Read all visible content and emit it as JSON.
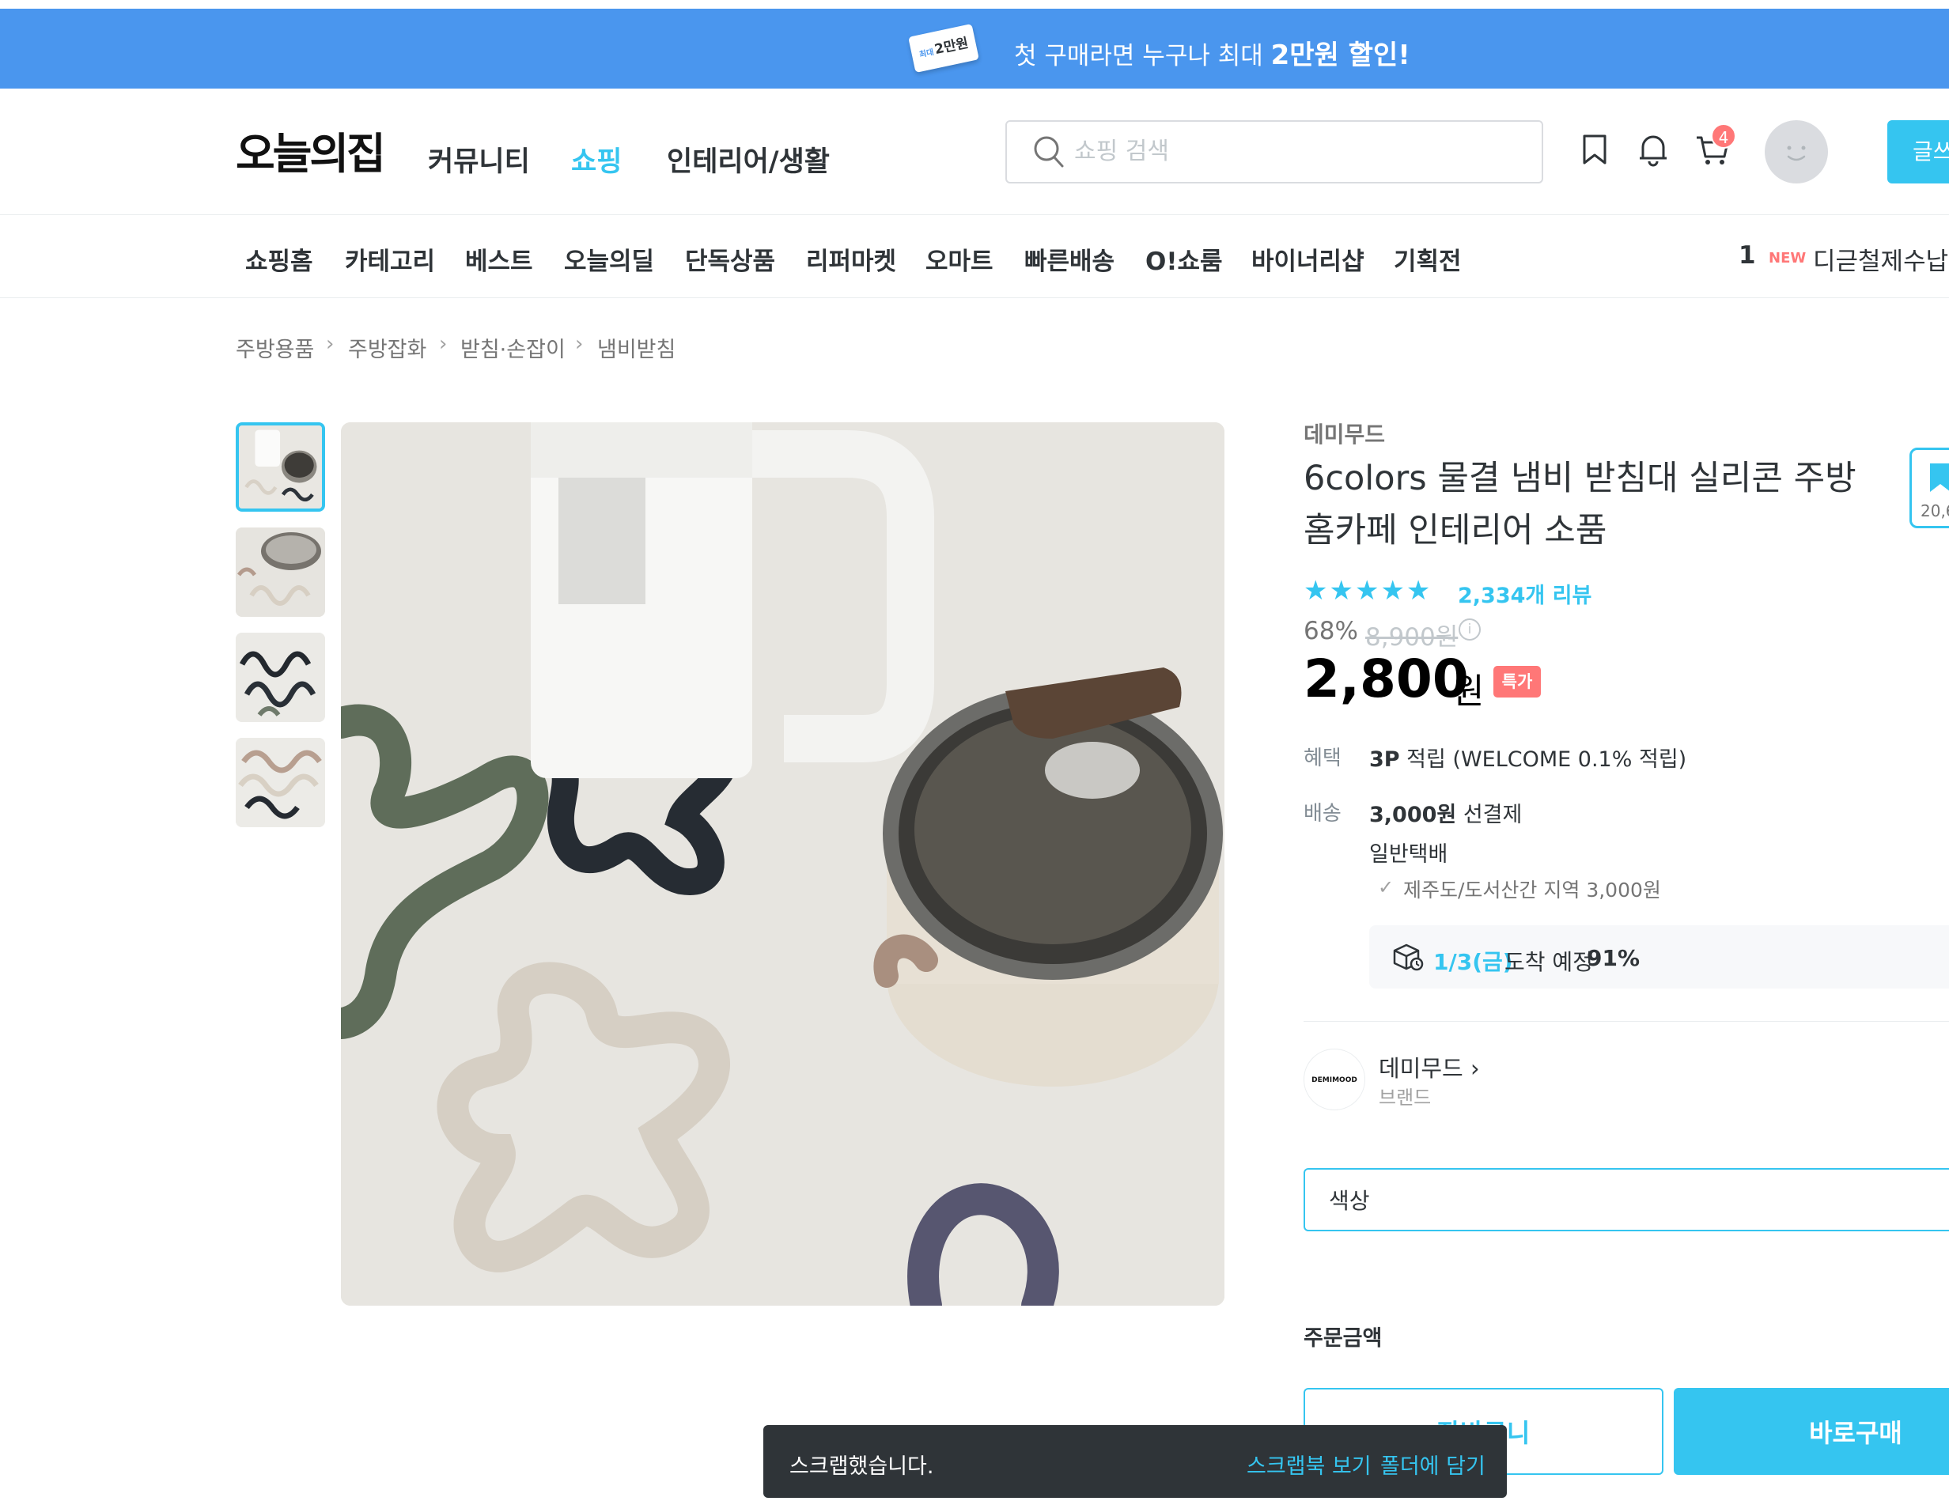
{
  "promo": {
    "ticket_label": "2만원",
    "ticket_small": "최대",
    "text_prefix": "첫 구매라면 누구나 최대 ",
    "text_highlight": "2만원 할인!",
    "arrow": "›"
  },
  "header": {
    "logo": "오늘의집",
    "nav": [
      "커뮤니티",
      "쇼핑",
      "인테리어/생활"
    ],
    "search_placeholder": "쇼핑 검색",
    "cart_count": "4",
    "write_label": "글쓰기"
  },
  "category_nav": {
    "items": [
      "쇼핑홈",
      "카테고리",
      "베스트",
      "오늘의딜",
      "단독상품",
      "리퍼마켓",
      "오마트",
      "빠른배송",
      "O!쇼룸",
      "바이너리샵",
      "기획전"
    ],
    "trending_rank": "1",
    "trending_badge": "NEW",
    "trending_text": "디귿철제수납함"
  },
  "breadcrumb": [
    "주방용품",
    "주방잡화",
    "받침·손잡이",
    "냄비받침"
  ],
  "product": {
    "brand": "데미무드",
    "title": "6colors 물결 냄비 받침대 실리콘 주방 홈카페 인테리어 소품",
    "stars": "★★★★★",
    "review_count": "2,334개 리뷰",
    "discount_rate": "68%",
    "original_price": "8,900원",
    "sale_price": "2,800",
    "price_unit": "원",
    "special_badge": "특가",
    "benefit_label": "혜택",
    "benefit_value_bold": "3P",
    "benefit_value": " 적립 (WELCOME 0.1% 적립)",
    "delivery_label": "배송",
    "delivery_fee_bold": "3,000원",
    "delivery_fee": " 선결제",
    "delivery_type": "일반택배",
    "island_note": "제주도/도서산간 지역 3,000원",
    "eta_date": "1/3(금)",
    "eta_label": "도착 예정",
    "eta_percent": "91%",
    "brand_link": "데미무드 ›",
    "brand_sub": "브랜드",
    "brand_logo_text": "DEMIMOOD",
    "color_select": "색상",
    "order_label": "주문금액",
    "cart_button": "장바구니",
    "buy_button": "바로구매",
    "scrap_count": "20,6"
  },
  "toast": {
    "message": "스크랩했습니다.",
    "scrapbook_link": "스크랩북 보기",
    "folder_link": "폴더에 담기"
  },
  "colors": {
    "accent": "#35c5f0",
    "promo_bg": "#4a96ee",
    "badge_red": "#ff7777",
    "toast_bg": "#2f3438"
  }
}
